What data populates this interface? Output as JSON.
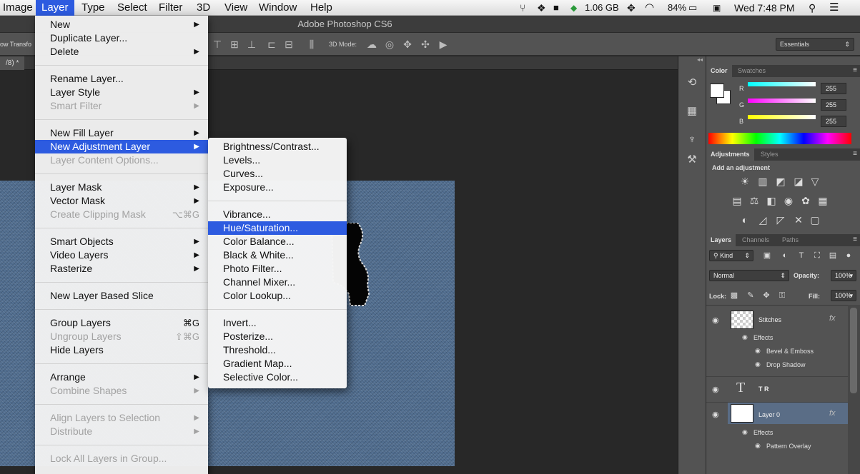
{
  "menubar": {
    "items": [
      "Image",
      "Layer",
      "Type",
      "Select",
      "Filter",
      "3D",
      "View",
      "Window",
      "Help"
    ],
    "memory": "1.06 GB",
    "battery": "84%",
    "clock": "Wed 7:48 PM"
  },
  "app": {
    "title": "Adobe Photoshop CS6",
    "options_left": "ow Transfo",
    "mode_label": "3D Mode:",
    "workspace": "Essentials",
    "doc_tab": "/8) *"
  },
  "layer_menu": {
    "items": [
      {
        "label": "New",
        "arrow": "▶"
      },
      {
        "label": "Duplicate Layer..."
      },
      {
        "label": "Delete",
        "arrow": "▶"
      },
      {
        "label": "Rename Layer..."
      },
      {
        "label": "Layer Style",
        "arrow": "▶"
      },
      {
        "label": "Smart Filter",
        "arrow": "▶"
      },
      {
        "label": "New Fill Layer",
        "arrow": "▶"
      },
      {
        "label": "New Adjustment Layer",
        "arrow": "▶"
      },
      {
        "label": "Layer Content Options..."
      },
      {
        "label": "Layer Mask",
        "arrow": "▶"
      },
      {
        "label": "Vector Mask",
        "arrow": "▶"
      },
      {
        "label": "Create Clipping Mask",
        "shortcut": "⌥⌘G"
      },
      {
        "label": "Smart Objects",
        "arrow": "▶"
      },
      {
        "label": "Video Layers",
        "arrow": "▶"
      },
      {
        "label": "Rasterize",
        "arrow": "▶"
      },
      {
        "label": "New Layer Based Slice"
      },
      {
        "label": "Group Layers",
        "shortcut": "⌘G"
      },
      {
        "label": "Ungroup Layers",
        "shortcut": "⇧⌘G"
      },
      {
        "label": "Hide Layers"
      },
      {
        "label": "Arrange",
        "arrow": "▶"
      },
      {
        "label": "Combine Shapes",
        "arrow": "▶"
      },
      {
        "label": "Align Layers to Selection",
        "arrow": "▶"
      },
      {
        "label": "Distribute",
        "arrow": "▶"
      },
      {
        "label": "Lock All Layers in Group..."
      }
    ]
  },
  "adjustment_submenu": {
    "items": [
      "Brightness/Contrast...",
      "Levels...",
      "Curves...",
      "Exposure...",
      "Vibrance...",
      "Hue/Saturation...",
      "Color Balance...",
      "Black & White...",
      "Photo Filter...",
      "Channel Mixer...",
      "Color Lookup...",
      "Invert...",
      "Posterize...",
      "Threshold...",
      "Gradient Map...",
      "Selective Color..."
    ]
  },
  "color_panel": {
    "tabs": [
      "Color",
      "Swatches"
    ],
    "channels": [
      {
        "label": "R",
        "value": "255",
        "color": "#00ffff"
      },
      {
        "label": "G",
        "value": "255",
        "color": "#ff00ff"
      },
      {
        "label": "B",
        "value": "255",
        "color": "#ffff00"
      }
    ]
  },
  "adjustments_panel": {
    "tabs": [
      "Adjustments",
      "Styles"
    ],
    "heading": "Add an adjustment"
  },
  "layers_panel": {
    "tabs": [
      "Layers",
      "Channels",
      "Paths"
    ],
    "filter": "Kind",
    "blend_mode": "Normal",
    "opacity_label": "Opacity:",
    "opacity": "100%",
    "lock_label": "Lock:",
    "fill_label": "Fill:",
    "fill": "100%",
    "layers": [
      {
        "name": "Stitches",
        "effects_label": "Effects",
        "effects": [
          "Bevel & Emboss",
          "Drop Shadow"
        ]
      },
      {
        "name": "T R"
      },
      {
        "name": "Layer 0",
        "effects_label": "Effects",
        "effects": [
          "Pattern Overlay"
        ]
      }
    ],
    "fx": "fx",
    "type_glyph": "T"
  },
  "colors": {
    "menu_highlight": "#2d5be0",
    "canvas_bg": "#282828",
    "panel_bg": "#535353",
    "denim": "#4d6a8c"
  }
}
